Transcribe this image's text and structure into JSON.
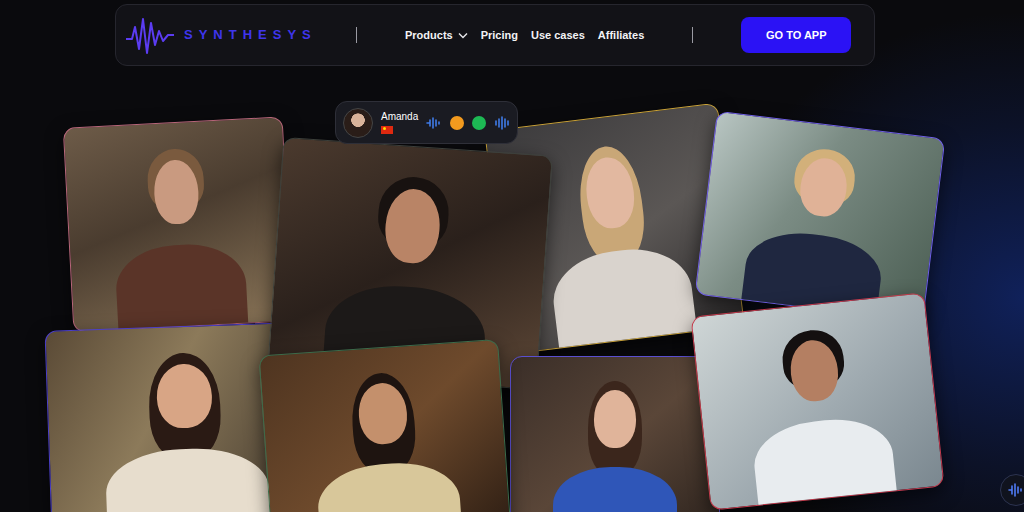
{
  "brand": {
    "name": "SYNTHESYS"
  },
  "nav": {
    "items": [
      {
        "label": "Products",
        "dropdown": true
      },
      {
        "label": "Pricing",
        "dropdown": false
      },
      {
        "label": "Use cases",
        "dropdown": false
      },
      {
        "label": "Affiliates",
        "dropdown": false
      }
    ],
    "cta": "GO TO APP"
  },
  "voice_badge": {
    "name": "Amanda"
  },
  "videos": [
    {
      "color": "#b8677a"
    },
    {
      "color": "#3c3f3a"
    },
    {
      "color": "#c9a23a"
    },
    {
      "color": "#7060e6"
    },
    {
      "color": "#4b3fc8"
    },
    {
      "color": "#3d6b4a"
    },
    {
      "color": "#5a4fd0"
    },
    {
      "color": "#c23a4c"
    }
  ]
}
